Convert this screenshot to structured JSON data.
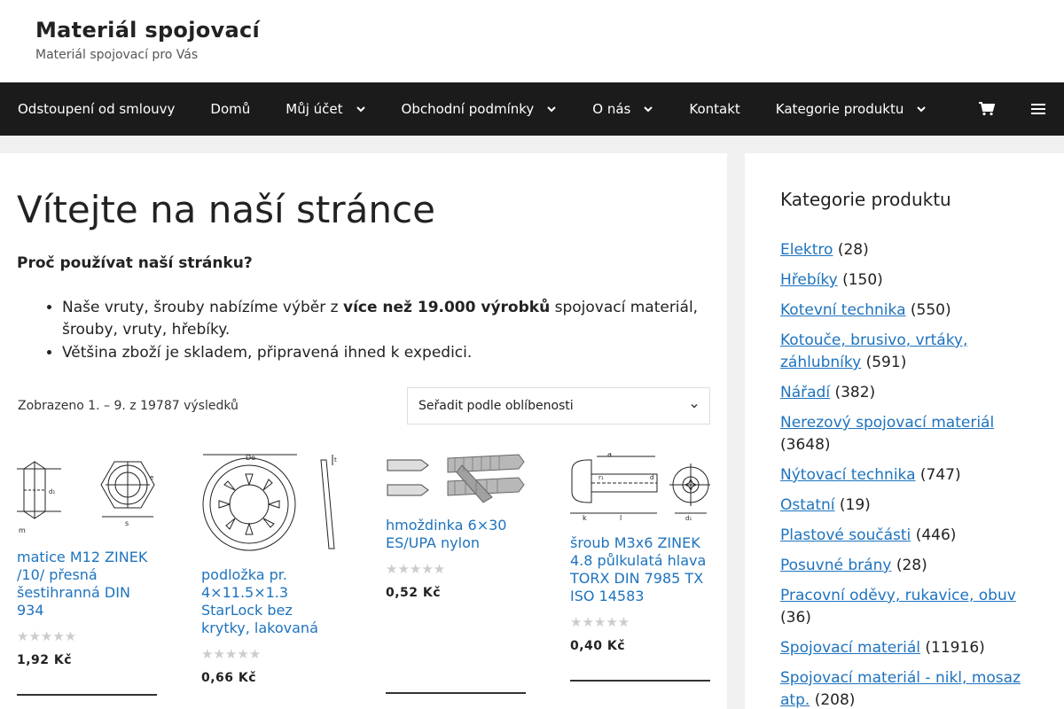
{
  "header": {
    "site_title": "Materiál spojovací",
    "tagline": "Materiál spojovací pro Vás"
  },
  "nav": {
    "items": [
      {
        "label": "Odstoupení od smlouvy",
        "dropdown": false
      },
      {
        "label": "Domů",
        "dropdown": false
      },
      {
        "label": "Můj účet",
        "dropdown": true
      },
      {
        "label": "Obchodní podmínky",
        "dropdown": true
      },
      {
        "label": "O nás",
        "dropdown": true
      },
      {
        "label": "Kontakt",
        "dropdown": false
      },
      {
        "label": "Kategorie produktu",
        "dropdown": true
      }
    ],
    "cart_icon": "cart-icon",
    "menu_icon": "hamburger-icon"
  },
  "main": {
    "title": "Vítejte na naší stránce",
    "intro_heading": "Proč používat naší stránku?",
    "bullet1_pre": "Naše vruty, šrouby nabízíme výběr z ",
    "bullet1_bold": "více než 19.000 výrobků",
    "bullet1_post": " spojovací materiál, šrouby, vruty, hřebíky.",
    "bullet2": "Většina zboží je skladem, připravená ihned k expedici.",
    "result_count": "Zobrazeno 1. – 9. z 19787 výsledků",
    "sort_selected": "Seřadit podle oblíbenosti"
  },
  "products": [
    {
      "name": "matice M12 ZINEK /10/ přesná šestihranná DIN 934",
      "price": "1,92 Kč",
      "rating": 0
    },
    {
      "name": "podložka pr. 4×11.5×1.3 StarLock bez krytky, lakovaná",
      "price": "0,66 Kč",
      "rating": 0
    },
    {
      "name": "hmoždinka 6×30 ES/UPA nylon",
      "price": "0,52 Kč",
      "rating": 0
    },
    {
      "name": "šroub M3x6 ZINEK 4.8 půlkulatá hlava TORX DIN 7985 TX ISO 14583",
      "price": "0,40 Kč",
      "rating": 0
    }
  ],
  "sidebar": {
    "title": "Kategorie produktu",
    "categories": [
      {
        "name": "Elektro",
        "count": "(28)"
      },
      {
        "name": "Hřebíky",
        "count": "(150)"
      },
      {
        "name": "Kotevní technika",
        "count": "(550)"
      },
      {
        "name": "Kotouče, brusivo, vrtáky, záhlubníky",
        "count": "(591)"
      },
      {
        "name": "Nářadí",
        "count": "(382)"
      },
      {
        "name": "Nerezový spojovací materiál",
        "count": "(3648)"
      },
      {
        "name": "Nýtovací technika",
        "count": "(747)"
      },
      {
        "name": "Ostatní",
        "count": "(19)"
      },
      {
        "name": "Plastové součásti",
        "count": "(446)"
      },
      {
        "name": "Posuvné brány",
        "count": "(28)"
      },
      {
        "name": "Pracovní oděvy, rukavice, obuv",
        "count": "(36)"
      },
      {
        "name": "Spojovací materiál",
        "count": "(11916)"
      },
      {
        "name": "Spojovací materiál - nikl, mosaz atp.",
        "count": "(208)"
      }
    ]
  },
  "colors": {
    "link": "#1e73be",
    "nav_bg": "#1b1b1b",
    "page_bg": "#f0f0f0"
  }
}
